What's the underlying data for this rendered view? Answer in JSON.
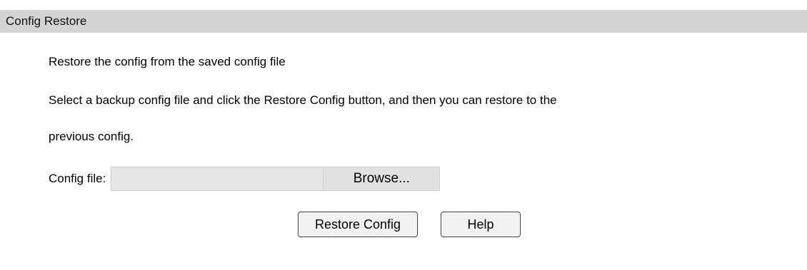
{
  "section": {
    "title": "Config Restore"
  },
  "content": {
    "heading": "Restore the config from the saved config file",
    "description_line1": "Select a backup config file and click the Restore Config button, and then you can restore to the",
    "description_line2": "previous config."
  },
  "config_file": {
    "label": "Config file:",
    "value": "",
    "browse_label": "Browse..."
  },
  "actions": {
    "restore_label": "Restore Config",
    "help_label": "Help"
  },
  "colors": {
    "header_background": "#d4d4d4",
    "page_background": "#ffffff",
    "field_background": "#e6e6e6"
  }
}
